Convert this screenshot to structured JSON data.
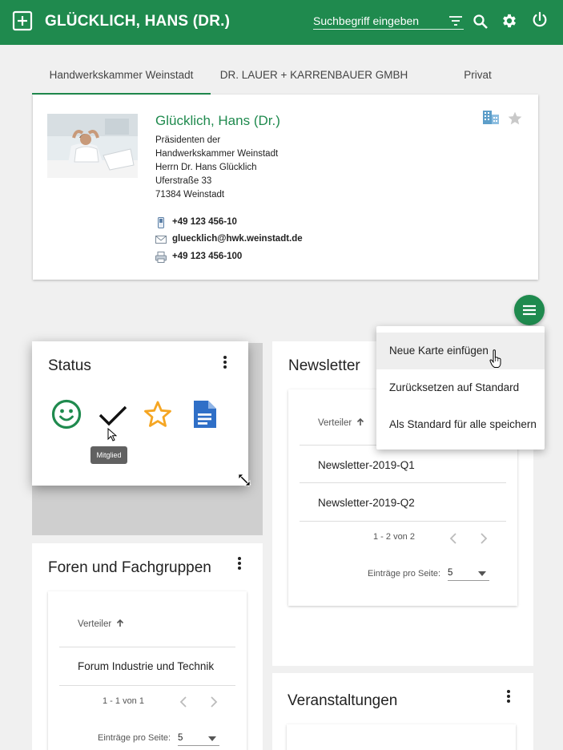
{
  "header": {
    "title": "GLÜCKLICH, HANS (DR.)",
    "search_placeholder": "Suchbegriff eingeben"
  },
  "tabs": [
    {
      "label": "Handwerkskammer Weinstadt",
      "active": true
    },
    {
      "label": "DR. LAUER + KARRENBAUER GMBH",
      "active": false
    },
    {
      "label": "Privat",
      "active": false
    }
  ],
  "contact": {
    "name": "Glücklich, Hans (Dr.)",
    "address_lines": [
      "Präsidenten der",
      "Handwerkskammer Weinstadt",
      "Herrn Dr. Hans Glücklich",
      "Uferstraße 33",
      "71384 Weinstadt"
    ],
    "phone": "+49 123 456-10",
    "email": "gluecklich@hwk.weinstadt.de",
    "fax": "+49 123 456-100"
  },
  "menu": {
    "items": [
      "Neue Karte einfügen",
      "Zurücksetzen auf Standard",
      "Als Standard für alle speichern"
    ]
  },
  "status_card": {
    "title": "Status",
    "tooltip": "Mitglied",
    "icons": [
      "smiley-icon",
      "check-icon",
      "star-outline-icon",
      "document-icon"
    ]
  },
  "newsletter": {
    "title": "Newsletter",
    "column": "Verteiler",
    "rows": [
      "Newsletter-2019-Q1",
      "Newsletter-2019-Q2"
    ],
    "pager": "1 - 2 von 2",
    "per_page_label": "Einträge pro Seite:",
    "per_page_value": "5"
  },
  "foren": {
    "title": "Foren und Fachgruppen",
    "column": "Verteiler",
    "rows": [
      "Forum Industrie und Technik"
    ],
    "pager": "1 - 1 von 1",
    "per_page_label": "Einträge pro Seite:",
    "per_page_value": "5"
  },
  "veranstaltungen": {
    "title": "Veranstaltungen"
  },
  "colors": {
    "brand_green": "#1f8a4e",
    "background": "#f0f0f0",
    "accent_blue": "#2f6fc7",
    "accent_orange": "#f5a623"
  }
}
